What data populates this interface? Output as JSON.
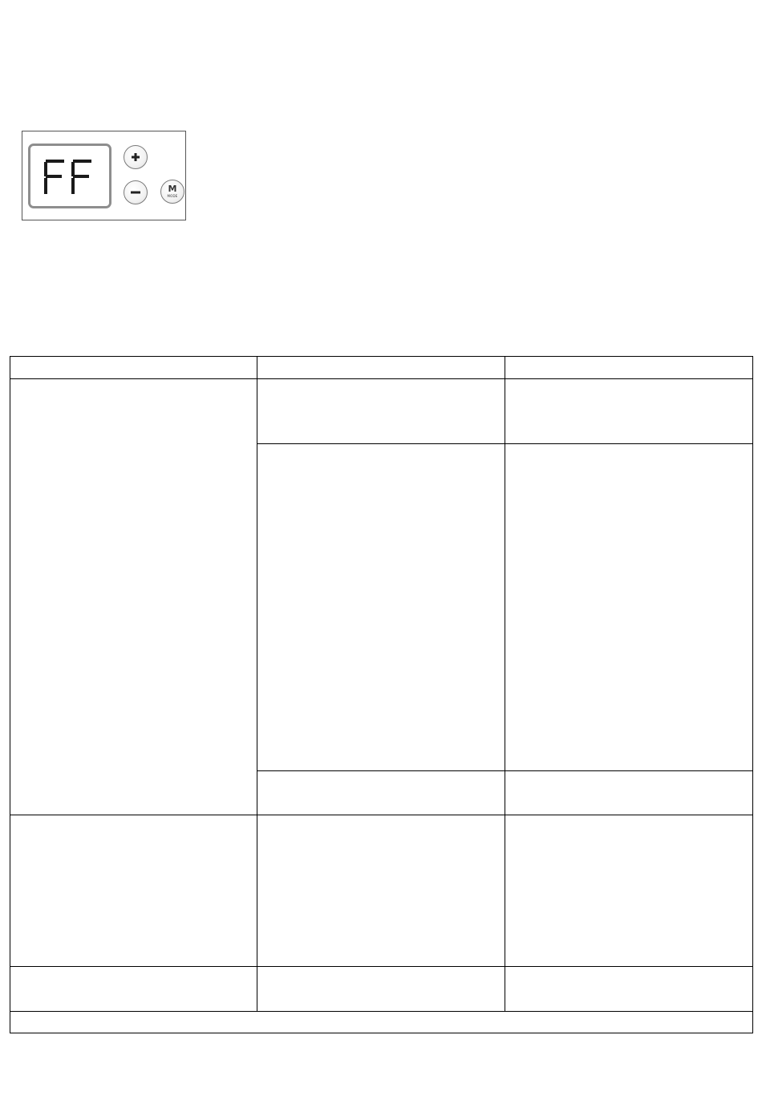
{
  "control_panel": {
    "display_text": "FF",
    "buttons": {
      "plus_label": "+",
      "minus_label": "−",
      "mode_label": "M",
      "mode_sub_label": "MODE"
    },
    "colors": {
      "frame": "#8e8e8e",
      "segments": "#1a1a1a",
      "button_border": "#7a7a7a"
    }
  },
  "table": {
    "header": [
      "",
      "",
      ""
    ],
    "rows": [
      {
        "col1": "",
        "col2": "",
        "col3": ""
      },
      {
        "col1": "",
        "col2": "",
        "col3": ""
      },
      {
        "col1": "",
        "col2": "",
        "col3": ""
      },
      {
        "col1": "",
        "col2": "",
        "col3": ""
      },
      {
        "col1": "",
        "col2": "",
        "col3": ""
      }
    ],
    "footer": ""
  }
}
